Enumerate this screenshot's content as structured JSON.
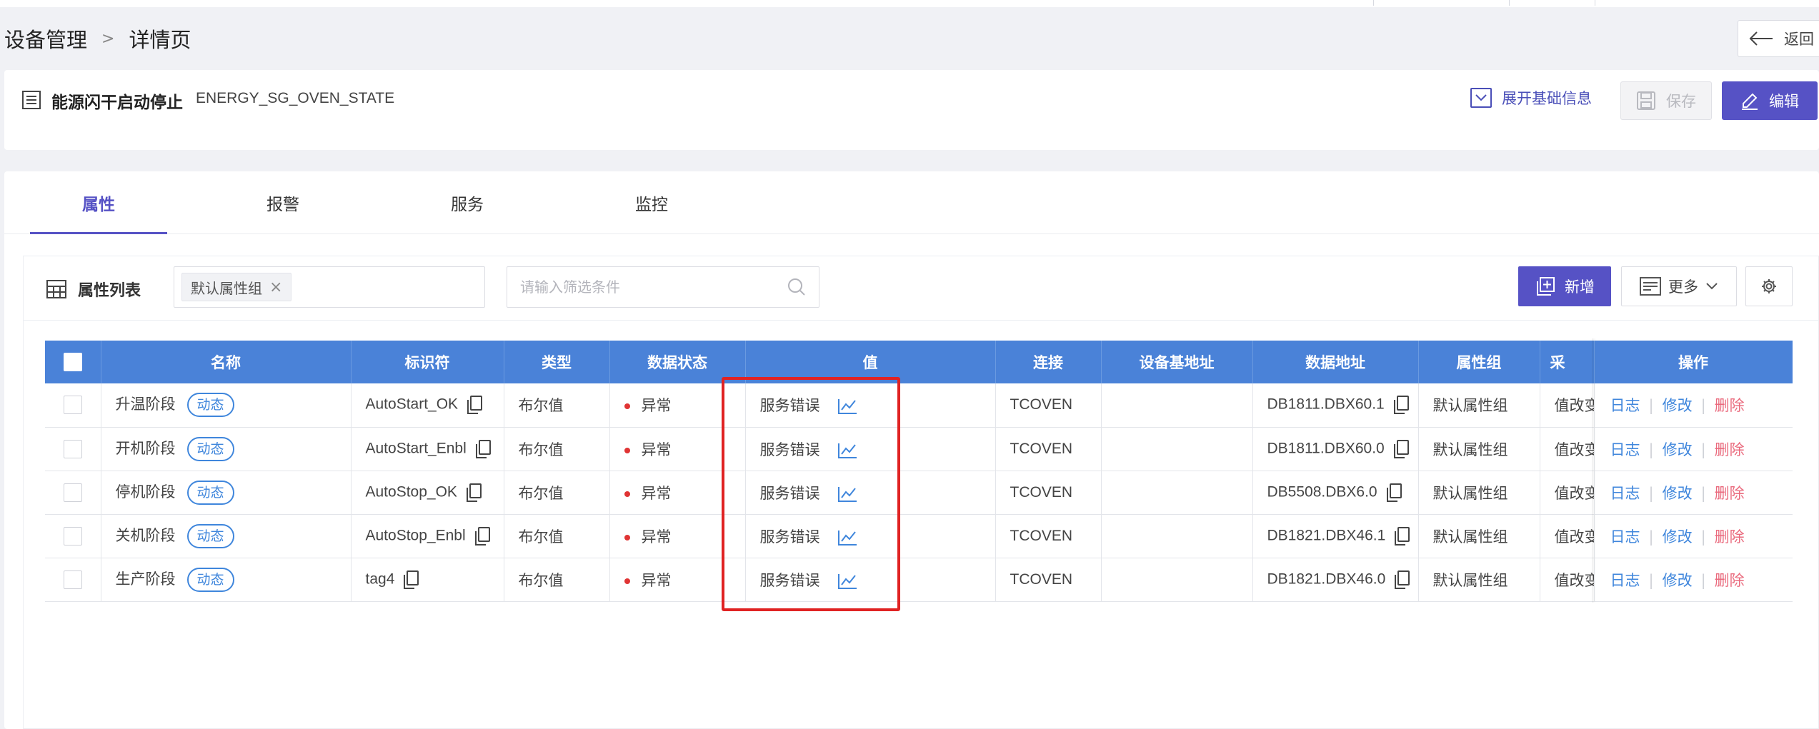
{
  "breadcrumb": {
    "parent": "设备管理",
    "separator": ">",
    "current": "详情页"
  },
  "back_label": "返回",
  "info": {
    "name": "能源闪干启动停止",
    "code": "ENERGY_SG_OVEN_STATE",
    "expand_label": "展开基础信息",
    "save_label": "保存",
    "edit_label": "编辑"
  },
  "tabs": [
    {
      "label": "属性"
    },
    {
      "label": "报警"
    },
    {
      "label": "服务"
    },
    {
      "label": "监控"
    }
  ],
  "toolbar": {
    "title": "属性列表",
    "group_tag": "默认属性组",
    "filter_placeholder": "请输入筛选条件",
    "add_label": "新增",
    "more_label": "更多"
  },
  "table": {
    "columns": [
      "名称",
      "标识符",
      "类型",
      "数据状态",
      "值",
      "连接",
      "设备基地址",
      "数据地址",
      "属性组",
      "采",
      "操作"
    ],
    "rows": [
      {
        "name": "升温阶段",
        "badge": "动态",
        "identifier": "AutoStart_OK",
        "type": "布尔值",
        "status": "异常",
        "value": "服务错误",
        "connection": "TCOVEN",
        "base_address": "",
        "data_address": "DB1811.DBX60.1",
        "group": "默认属性组",
        "collect": "值改变"
      },
      {
        "name": "开机阶段",
        "badge": "动态",
        "identifier": "AutoStart_Enbl",
        "type": "布尔值",
        "status": "异常",
        "value": "服务错误",
        "connection": "TCOVEN",
        "base_address": "",
        "data_address": "DB1811.DBX60.0",
        "group": "默认属性组",
        "collect": "值改变"
      },
      {
        "name": "停机阶段",
        "badge": "动态",
        "identifier": "AutoStop_OK",
        "type": "布尔值",
        "status": "异常",
        "value": "服务错误",
        "connection": "TCOVEN",
        "base_address": "",
        "data_address": "DB5508.DBX6.0",
        "group": "默认属性组",
        "collect": "值改变"
      },
      {
        "name": "关机阶段",
        "badge": "动态",
        "identifier": "AutoStop_Enbl",
        "type": "布尔值",
        "status": "异常",
        "value": "服务错误",
        "connection": "TCOVEN",
        "base_address": "",
        "data_address": "DB1821.DBX46.1",
        "group": "默认属性组",
        "collect": "值改变"
      },
      {
        "name": "生产阶段",
        "badge": "动态",
        "identifier": "tag4",
        "type": "布尔值",
        "status": "异常",
        "value": "服务错误",
        "connection": "TCOVEN",
        "base_address": "",
        "data_address": "DB1821.DBX46.0",
        "group": "默认属性组",
        "collect": "值改变"
      }
    ],
    "row_actions": {
      "log": "日志",
      "edit": "修改",
      "delete": "删除",
      "separator": "|"
    }
  },
  "colors": {
    "accent": "#5652c5",
    "table_header": "#4a82d8",
    "link": "#3f86dc",
    "delete": "#ea6a7d",
    "status_dot": "#e03434",
    "highlight": "#e02323"
  },
  "icons": {
    "back": "arrow-left-icon",
    "info": "list-icon",
    "expand": "chevron-down-box-icon",
    "save": "floppy-disk-icon",
    "edit": "pencil-icon",
    "table": "grid-icon",
    "search": "search-icon",
    "add": "plus-box-icon",
    "more": "list-lines-icon",
    "settings": "gear-icon",
    "copy": "copy-icon",
    "trend": "trend-chart-icon"
  }
}
